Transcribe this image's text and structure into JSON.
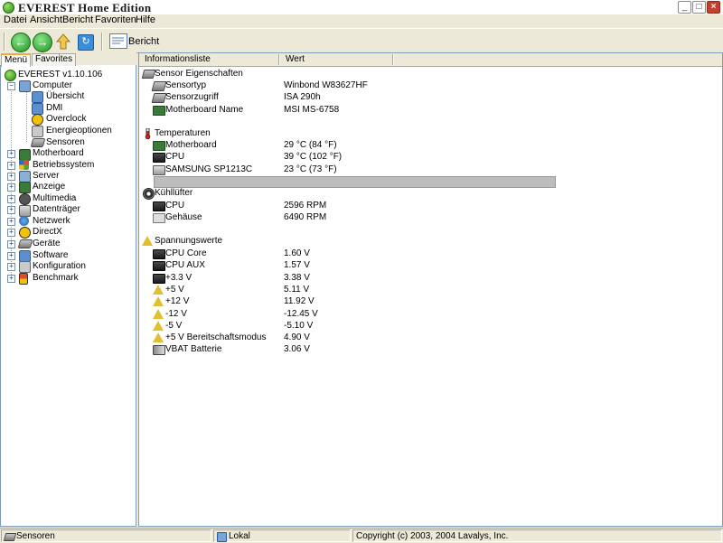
{
  "window": {
    "title": "EVEREST Home Edition"
  },
  "menu": [
    "Datei",
    "Ansicht",
    "Bericht",
    "Favoriten",
    "Hilfe"
  ],
  "toolbar": {
    "report_label": "Bericht"
  },
  "left_tabs": [
    "Menü",
    "Favorites"
  ],
  "tree": {
    "root": "EVEREST v1.10.106",
    "computer": "Computer",
    "computer_children": [
      "Übersicht",
      "DMI",
      "Overclock",
      "Energieoptionen",
      "Sensoren"
    ],
    "top_items": [
      "Motherboard",
      "Betriebssystem",
      "Server",
      "Anzeige",
      "Multimedia",
      "Datenträger",
      "Netzwerk",
      "DirectX",
      "Geräte",
      "Software",
      "Konfiguration",
      "Benchmark"
    ]
  },
  "columns": {
    "field": "Informationsliste",
    "value": "Wert"
  },
  "sections": {
    "sensor": {
      "title": "Sensor Eigenschaften",
      "rows": [
        {
          "label": "Sensortyp",
          "value": "Winbond W83627HF",
          "icon": "sensor-icon"
        },
        {
          "label": "Sensorzugriff",
          "value": "ISA 290h",
          "icon": "sensor-icon"
        },
        {
          "label": "Motherboard Name",
          "value": "MSI MS-6758",
          "icon": "motherboard-icon"
        }
      ]
    },
    "temps": {
      "title": "Temperaturen",
      "rows": [
        {
          "label": "Motherboard",
          "value": "29 °C  (84 °F)",
          "icon": "motherboard-icon"
        },
        {
          "label": "CPU",
          "value": "39 °C  (102 °F)",
          "icon": "cpu-icon"
        },
        {
          "label": "SAMSUNG SP1213C",
          "value": "23 °C  (73 °F)",
          "icon": "hdd-icon"
        }
      ]
    },
    "fans": {
      "title": "Kühllüfter",
      "rows": [
        {
          "label": "CPU",
          "value": "2596 RPM",
          "icon": "cpu-icon"
        },
        {
          "label": "Gehäuse",
          "value": "6490 RPM",
          "icon": "case-icon"
        }
      ]
    },
    "voltages": {
      "title": "Spannungswerte",
      "rows": [
        {
          "label": "CPU Core",
          "value": "1.60 V",
          "icon": "cpu-icon"
        },
        {
          "label": "CPU AUX",
          "value": "1.57 V",
          "icon": "cpu-icon"
        },
        {
          "label": "+3.3 V",
          "value": "3.38 V",
          "icon": "cpu-icon"
        },
        {
          "label": "+5 V",
          "value": "5.11 V",
          "icon": "warning-icon"
        },
        {
          "label": "+12 V",
          "value": "11.92 V",
          "icon": "warning-icon"
        },
        {
          "label": "-12 V",
          "value": "-12.45 V",
          "icon": "warning-icon"
        },
        {
          "label": "-5 V",
          "value": "-5.10 V",
          "icon": "warning-icon"
        },
        {
          "label": "+5 V Bereitschaftsmodus",
          "value": "4.90 V",
          "icon": "warning-icon"
        },
        {
          "label": "VBAT Batterie",
          "value": "3.06 V",
          "icon": "battery-icon"
        }
      ]
    }
  },
  "statusbar": {
    "left": "Sensoren",
    "middle": "Lokal",
    "right": "Copyright (c) 2003, 2004 Lavalys, Inc."
  }
}
